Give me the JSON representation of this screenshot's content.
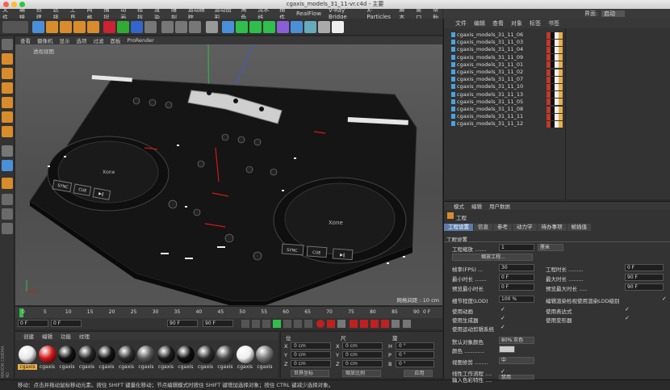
{
  "window": {
    "title": "cgaxis_models_31_11-vr.c4d - 主要"
  },
  "menubar": {
    "items": [
      "文件",
      "编辑",
      "创建",
      "选择",
      "工具",
      "网格",
      "捕捉",
      "动画",
      "模拟",
      "渲染",
      "雕刻",
      "运动跟踪",
      "运动图形",
      "角色",
      "流水线",
      "插件",
      "RealFlow",
      "V-Ray Bridge",
      "X-Particles",
      "脚本",
      "窗口",
      "帮助"
    ],
    "interface_label": "界面:",
    "interface_value": "启动"
  },
  "viewport": {
    "menu": [
      "查看",
      "摄像机",
      "显示",
      "选项",
      "过滤",
      "面板",
      "ProRender"
    ],
    "label": "透视视图",
    "grid_text": "网格间距 : 10 cm",
    "brand_left": "Xone",
    "brand_right": "Xone",
    "pads": [
      "SYNC",
      "CUE",
      "▶‖",
      "SYNC",
      "CUE",
      "▶‖"
    ]
  },
  "timeline": {
    "ticks": [
      "0",
      "5",
      "10",
      "15",
      "20",
      "25",
      "30",
      "35",
      "40",
      "45",
      "50",
      "55",
      "60",
      "65",
      "70",
      "75",
      "80",
      "85",
      "90"
    ],
    "frame_right": "0 F"
  },
  "transport": {
    "start": "0 F",
    "current": "0 F",
    "end": "90 F",
    "max": "90 F"
  },
  "material_panel": {
    "menu": [
      "创建",
      "编辑",
      "功能",
      "纹理"
    ],
    "materials": [
      "cgaxis",
      "cgaxis",
      "cgaxis",
      "cgaxis",
      "cgaxis",
      "cgaxis",
      "cgaxis",
      "cgaxis",
      "cgaxis",
      "cgaxis",
      "cgaxis",
      "cgaxis",
      "cgaxis"
    ]
  },
  "coordinates": {
    "headers": [
      "位",
      "尺",
      "旋"
    ],
    "rows": [
      {
        "axis": "X",
        "pos": "0 cm",
        "axis2": "X",
        "size": "0 cm",
        "axis3": "H",
        "rot": "0 °"
      },
      {
        "axis": "Y",
        "pos": "0 cm",
        "axis2": "Y",
        "size": "0 cm",
        "axis3": "P",
        "rot": "0 °"
      },
      {
        "axis": "Z",
        "pos": "0 cm",
        "axis2": "Z",
        "size": "0 cm",
        "axis3": "B",
        "rot": "0 °"
      }
    ],
    "mode": "世界坐标",
    "scale_mode": "缩放比例",
    "apply": "应用"
  },
  "status": {
    "text": "移动：点击并拖动鼠标移动元素。按住 SHIFT 键量化移动；节点编辑模式时按住 SHIFT 键增加选择对象；按住 CTRL 键减少选择对象。"
  },
  "object_panel": {
    "menu": [
      "文件",
      "编辑",
      "查看",
      "对象",
      "标签",
      "书签"
    ],
    "objects": [
      "cgaxis_models_31_11_06",
      "cgaxis_models_31_11_03",
      "cgaxis_models_31_11_04",
      "cgaxis_models_31_11_09",
      "cgaxis_models_31_11_01",
      "cgaxis_models_31_11_02",
      "cgaxis_models_31_11_07",
      "cgaxis_models_31_11_10",
      "cgaxis_models_31_11_13",
      "cgaxis_models_31_11_05",
      "cgaxis_models_31_11_08",
      "cgaxis_models_31_11_11",
      "cgaxis_models_31_11_12"
    ]
  },
  "attributes": {
    "menu": [
      "模式",
      "编辑",
      "用户数据"
    ],
    "title": "工程",
    "tabs": [
      "工程设置",
      "信息",
      "参考",
      "动力学",
      "待办事项",
      "帧插值"
    ],
    "section": "工程设置",
    "scale_label": "工程缩放 .......",
    "scale_value": "1",
    "scale_unit": "厘米",
    "scale_button": "缩放工程...",
    "fps_label": "帧率(FPS) ...",
    "fps_value": "30",
    "project_length_label": "工程时长 .........",
    "project_length_value": "0 F",
    "min_time_label": "最小时长 .......",
    "min_time_value": "0 F",
    "max_time_label": "最大时长 .........",
    "max_time_value": "90 F",
    "preview_min_label": "预览最小时长",
    "preview_min_value": "0 F",
    "preview_max_label": "预览最大时长 .....",
    "preview_max_value": "90 F",
    "lod_label": "细节程度(LOD)",
    "lod_value": "100 %",
    "lod_render_label": "编辑渲染检视使用渲染LOD级别",
    "use_anim": "使用动画",
    "use_expr": "使用表达式",
    "use_gen": "使用生成器",
    "use_deform": "使用变形器",
    "use_motion": "使用运动剪辑系统",
    "default_color_label": "默认对象颜色",
    "default_color_value": "80% 灰色",
    "color_label": "颜色 ............",
    "view_clip_label": "视图修剪 ........",
    "view_clip_value": "中",
    "linear_label": "线性工作流程 ....",
    "input_color_label": "输入色彩特性 ....",
    "input_color_value": "禁用"
  },
  "colors": {
    "accent": "#e8b04b",
    "selection": "#5b7ca8",
    "green": "#2fbf4a",
    "red": "#d01818"
  }
}
